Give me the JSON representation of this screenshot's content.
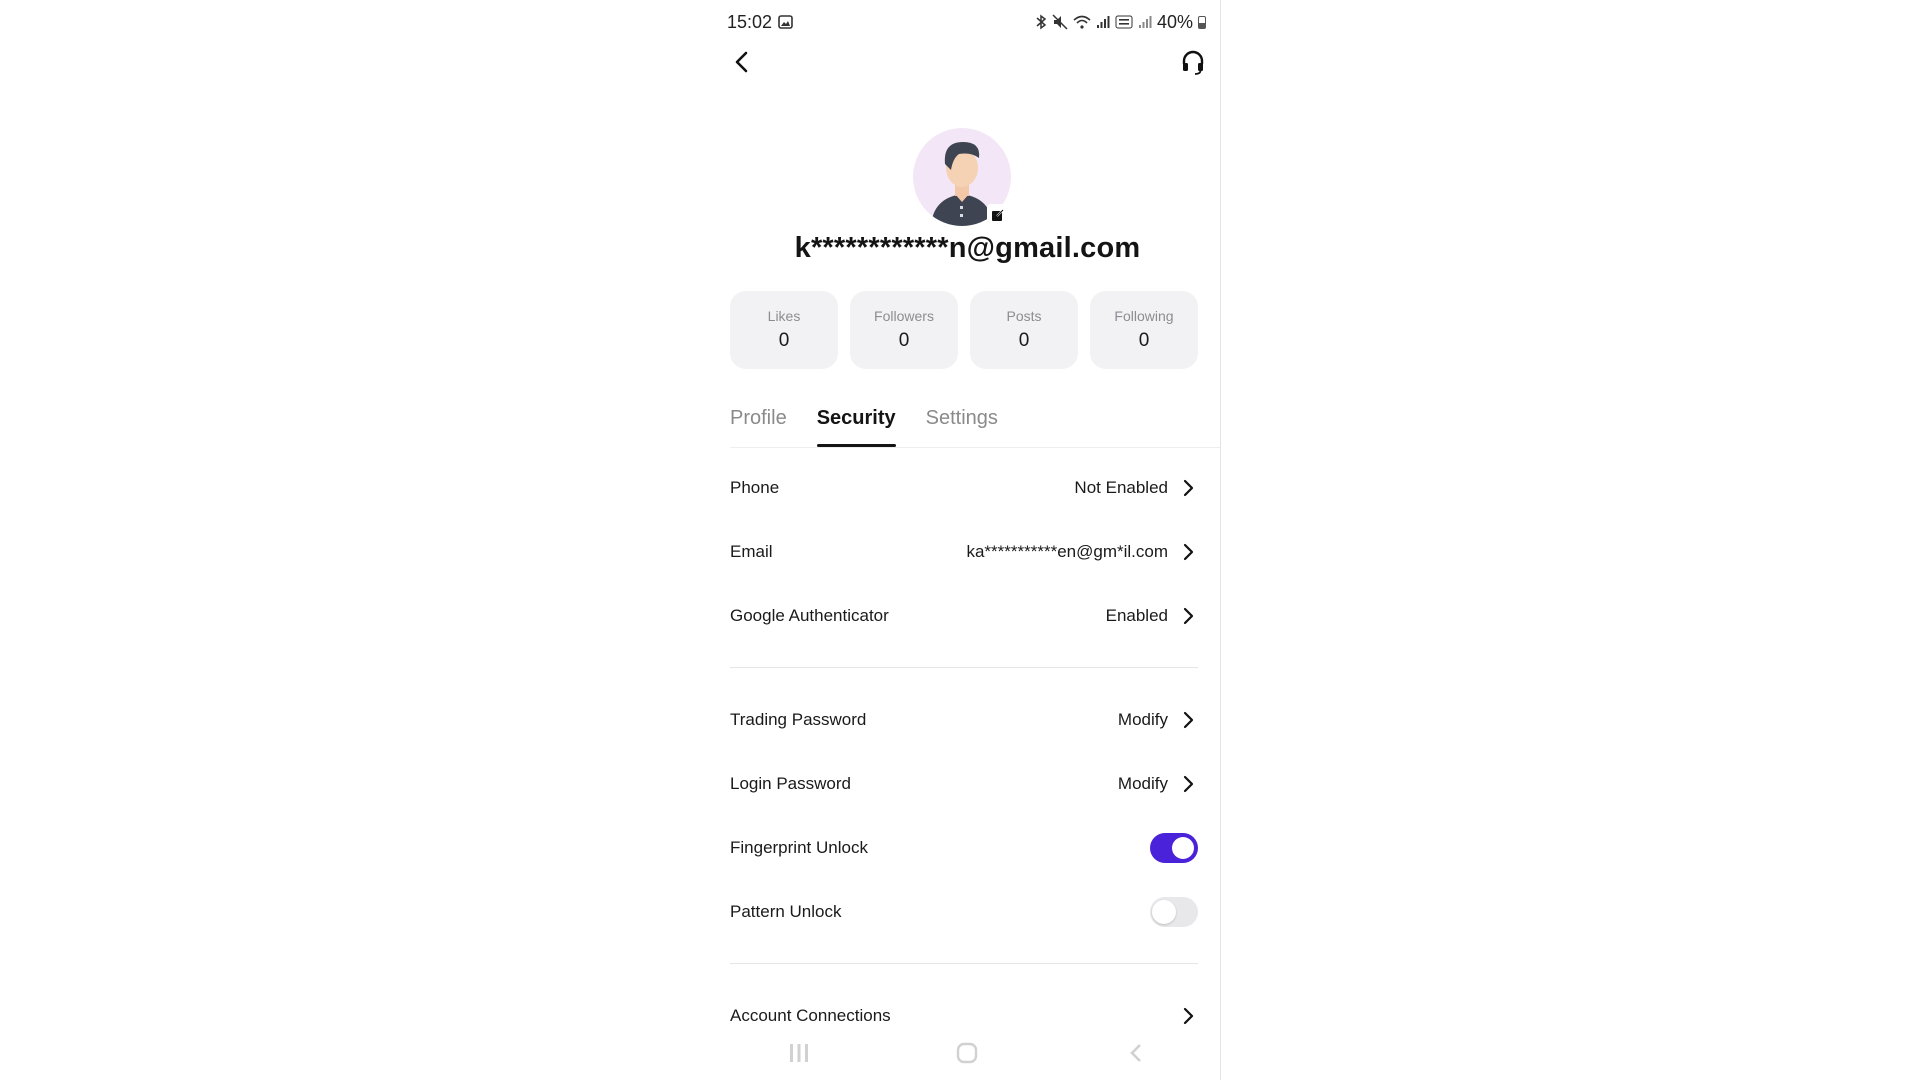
{
  "status_bar": {
    "time": "15:02",
    "battery": "40%"
  },
  "profile": {
    "email_masked": "k************n@gmail.com"
  },
  "stats": [
    {
      "label": "Likes",
      "value": "0"
    },
    {
      "label": "Followers",
      "value": "0"
    },
    {
      "label": "Posts",
      "value": "0"
    },
    {
      "label": "Following",
      "value": "0"
    }
  ],
  "tabs": [
    {
      "label": "Profile",
      "active": false
    },
    {
      "label": "Security",
      "active": true
    },
    {
      "label": "Settings",
      "active": false
    }
  ],
  "security": {
    "phone": {
      "label": "Phone",
      "value": "Not Enabled"
    },
    "email": {
      "label": "Email",
      "value": "ka***********en@gm*il.com"
    },
    "google_auth": {
      "label": "Google Authenticator",
      "value": "Enabled"
    },
    "trading_password": {
      "label": "Trading Password",
      "value": "Modify"
    },
    "login_password": {
      "label": "Login Password",
      "value": "Modify"
    },
    "fingerprint": {
      "label": "Fingerprint Unlock",
      "enabled": true
    },
    "pattern": {
      "label": "Pattern Unlock",
      "enabled": false
    },
    "account_connections": {
      "label": "Account Connections"
    }
  },
  "colors": {
    "accent": "#4a22d9",
    "stat_bg": "#f2f2f4",
    "avatar_bg": "#f3e6f6"
  },
  "icons": {
    "back": "chevron-left-icon",
    "support": "headset-icon",
    "row_chevron": "chevron-right-icon",
    "edit": "edit-icon"
  }
}
